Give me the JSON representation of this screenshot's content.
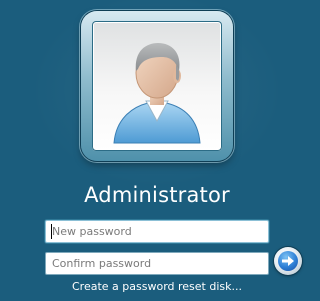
{
  "user": {
    "name": "Administrator",
    "avatar_icon": "user-avatar-icon"
  },
  "form": {
    "new_password": {
      "value": "",
      "placeholder": "New password"
    },
    "confirm_password": {
      "value": "",
      "placeholder": "Confirm password"
    },
    "submit_icon": "arrow-right-icon"
  },
  "links": {
    "reset_disk": "Create a password reset disk..."
  },
  "colors": {
    "background": "#1b5d7d",
    "text": "#ffffff",
    "submit_button": "#2d7fd6"
  }
}
